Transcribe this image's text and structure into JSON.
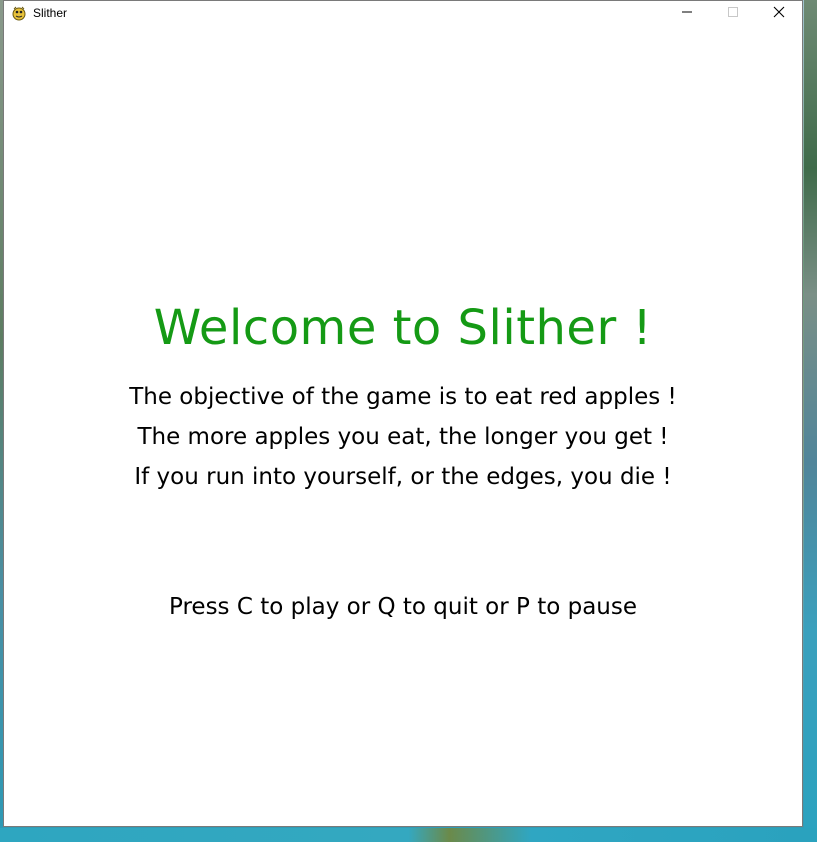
{
  "window": {
    "title": "Slither"
  },
  "game": {
    "welcome_title": "Welcome to Slither !",
    "instructions": [
      "The objective of the game is to eat red apples !",
      "The more apples you eat, the longer you get !",
      "If you run into yourself, or the edges, you die !"
    ],
    "controls_prompt": "Press C to play or Q to quit or P to pause"
  },
  "colors": {
    "title_green": "#159a15",
    "text": "#000000",
    "background": "#ffffff"
  },
  "icons": {
    "app": "pygame-snake-icon",
    "minimize": "minimize-icon",
    "maximize": "maximize-icon",
    "close": "close-icon"
  }
}
